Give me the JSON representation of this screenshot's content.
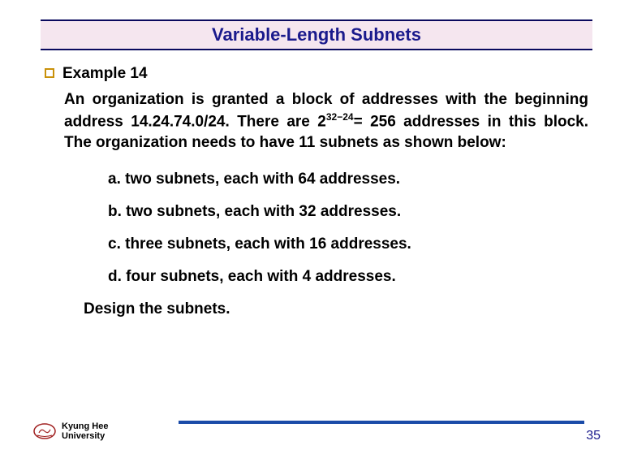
{
  "title": "Variable-Length Subnets",
  "example_label": "Example 14",
  "body_pre": "An organization is granted a block of addresses with the beginning address 14.24.74.0/24. There are 2",
  "body_sup": "32−24",
  "body_post": "= 256 addresses in this block. The organization needs to have 11 subnets as shown below:",
  "items": {
    "a": "a. two subnets, each with 64 addresses.",
    "b": "b. two subnets, each with 32 addresses.",
    "c": "c. three subnets, each with 16 addresses.",
    "d": "d. four subnets, each with 4 addresses."
  },
  "design": "Design the subnets.",
  "university_line1": "Kyung Hee",
  "university_line2": "University",
  "page_number": "35"
}
